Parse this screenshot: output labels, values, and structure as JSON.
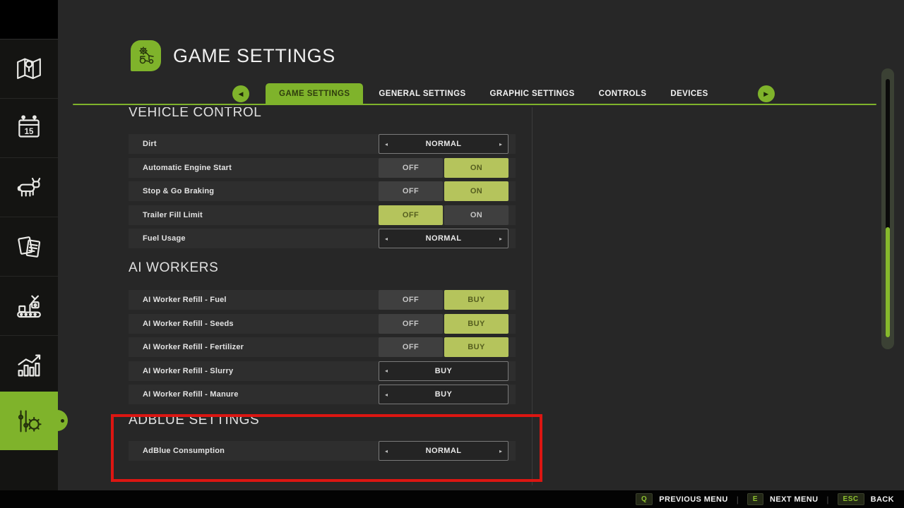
{
  "header": {
    "title": "GAME SETTINGS",
    "icon": "tractor-gear-icon"
  },
  "tabs": {
    "prev_arrow": "◀",
    "next_arrow": "▶",
    "items": [
      {
        "label": "GAME SETTINGS",
        "active": true
      },
      {
        "label": "GENERAL SETTINGS",
        "active": false
      },
      {
        "label": "GRAPHIC SETTINGS",
        "active": false
      },
      {
        "label": "CONTROLS",
        "active": false
      },
      {
        "label": "DEVICES",
        "active": false
      }
    ]
  },
  "sidebar": {
    "items": [
      {
        "icon": "map-icon",
        "active": false
      },
      {
        "icon": "calendar-icon",
        "active": false
      },
      {
        "icon": "animals-icon",
        "active": false
      },
      {
        "icon": "contracts-icon",
        "active": false
      },
      {
        "icon": "production-icon",
        "active": false
      },
      {
        "icon": "statistics-icon",
        "active": false
      },
      {
        "icon": "settings-icon",
        "active": true
      }
    ]
  },
  "sections": [
    {
      "title": "VEHICLE CONTROL",
      "rows": [
        {
          "label": "Dirt",
          "control": {
            "type": "selector",
            "value": "NORMAL",
            "left_arrow": true,
            "right_arrow": true
          }
        },
        {
          "label": "Automatic Engine Start",
          "control": {
            "type": "toggle",
            "options": [
              "OFF",
              "ON"
            ],
            "active": "ON"
          }
        },
        {
          "label": "Stop & Go Braking",
          "control": {
            "type": "toggle",
            "options": [
              "OFF",
              "ON"
            ],
            "active": "ON"
          }
        },
        {
          "label": "Trailer Fill Limit",
          "control": {
            "type": "toggle",
            "options": [
              "OFF",
              "ON"
            ],
            "active": "OFF"
          }
        },
        {
          "label": "Fuel Usage",
          "control": {
            "type": "selector",
            "value": "NORMAL",
            "left_arrow": true,
            "right_arrow": true
          }
        }
      ]
    },
    {
      "title": "AI WORKERS",
      "rows": [
        {
          "label": "AI Worker Refill - Fuel",
          "control": {
            "type": "toggle",
            "options": [
              "OFF",
              "BUY"
            ],
            "active": "BUY"
          }
        },
        {
          "label": "AI Worker Refill - Seeds",
          "control": {
            "type": "toggle",
            "options": [
              "OFF",
              "BUY"
            ],
            "active": "BUY"
          }
        },
        {
          "label": "AI Worker Refill - Fertilizer",
          "control": {
            "type": "toggle",
            "options": [
              "OFF",
              "BUY"
            ],
            "active": "BUY"
          }
        },
        {
          "label": "AI Worker Refill - Slurry",
          "control": {
            "type": "selector",
            "value": "BUY",
            "left_arrow": true,
            "right_arrow": false
          }
        },
        {
          "label": "AI Worker Refill - Manure",
          "control": {
            "type": "selector",
            "value": "BUY",
            "left_arrow": true,
            "right_arrow": false
          }
        }
      ]
    },
    {
      "title": "ADBLUE SETTINGS",
      "rows": [
        {
          "label": "AdBlue Consumption",
          "control": {
            "type": "selector",
            "value": "NORMAL",
            "left_arrow": true,
            "right_arrow": true
          }
        }
      ]
    }
  ],
  "selector_arrows": {
    "left": "◂",
    "right": "▸"
  },
  "footer": {
    "items": [
      {
        "key": "Q",
        "label": "PREVIOUS MENU"
      },
      {
        "key": "E",
        "label": "NEXT MENU"
      },
      {
        "key": "ESC",
        "label": "BACK"
      }
    ]
  },
  "annotation": {
    "type": "highlight-box",
    "color": "#dc1612",
    "target": "ADBLUE SETTINGS section"
  },
  "colors": {
    "accent_green": "#7fb32b",
    "toggle_active_green": "#b5c45c",
    "row_background": "#2e2e2e",
    "page_background": "#272727",
    "highlight_red": "#dc1612"
  }
}
